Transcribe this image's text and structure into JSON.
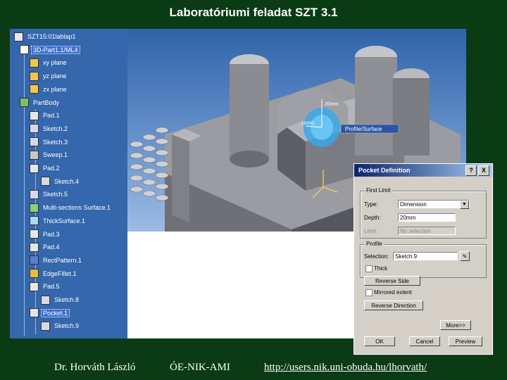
{
  "slide": {
    "title": "Laboratóriumi feladat SZT 3.1",
    "footer_author": "Dr. Horváth László",
    "footer_org": "ÓE-NIK-AMI",
    "footer_url": "http://users.nik.uni-obuda.hu/lhorvath/"
  },
  "tree": {
    "items": [
      {
        "label": "SZT15:01lablap1",
        "icon": "product-icon"
      },
      {
        "label": "3D-Part1.1/ML4",
        "icon": "part-icon",
        "selected": true
      },
      {
        "label": "xy plane",
        "icon": "plane-icon"
      },
      {
        "label": "yz plane",
        "icon": "plane-icon"
      },
      {
        "label": "zx plane",
        "icon": "plane-icon"
      },
      {
        "label": "PartBody",
        "icon": "gear-icon"
      },
      {
        "label": "Pad.1",
        "icon": "pad-icon"
      },
      {
        "label": "Sketch.2",
        "icon": "sketch-icon"
      },
      {
        "label": "Sketch.3",
        "icon": "sketch-icon"
      },
      {
        "label": "Sweep.1",
        "icon": "sweep-icon"
      },
      {
        "label": "Pad.2",
        "icon": "pad-icon"
      },
      {
        "label": "Sketch.4",
        "icon": "sketch-icon"
      },
      {
        "label": "Sketch.5",
        "icon": "sketch-icon"
      },
      {
        "label": "Multi-sections Surface.1",
        "icon": "surface-icon"
      },
      {
        "label": "ThickSurface.1",
        "icon": "thick-surface-icon"
      },
      {
        "label": "Pad.3",
        "icon": "pad-icon"
      },
      {
        "label": "Pad.4",
        "icon": "pad-icon"
      },
      {
        "label": "RectPattern.1",
        "icon": "pattern-icon"
      },
      {
        "label": "EdgeFillet.1",
        "icon": "fillet-icon"
      },
      {
        "label": "Pad.5",
        "icon": "pad-icon"
      },
      {
        "label": "Sketch.8",
        "icon": "sketch-icon"
      },
      {
        "label": "Pocket.1",
        "icon": "pocket-icon",
        "selected": true
      },
      {
        "label": "Sketch.9",
        "icon": "sketch-icon"
      }
    ]
  },
  "viewport": {
    "tooltip": "Profile/Surface",
    "dim_label": "20mm",
    "dim_label2": "Limit1"
  },
  "dialog": {
    "title": "Pocket Definition",
    "help_btn": "?",
    "close_btn": "X",
    "first_limit_label": "First Limit",
    "type_label": "Type:",
    "type_value": "Dimension",
    "depth_label": "Depth:",
    "depth_value": "20mm",
    "limit_label": "Limit:",
    "limit_value": "No selection",
    "profile_label": "Profile",
    "selection_label": "Selection:",
    "selection_value": "Sketch.9",
    "thick_label": "Thick",
    "reverse_side": "Reverse Side",
    "mirrored_label": "Mirrored extent",
    "reverse_direction": "Reverse Direction",
    "more": "More>>",
    "ok": "OK",
    "cancel": "Cancel",
    "preview": "Preview"
  }
}
